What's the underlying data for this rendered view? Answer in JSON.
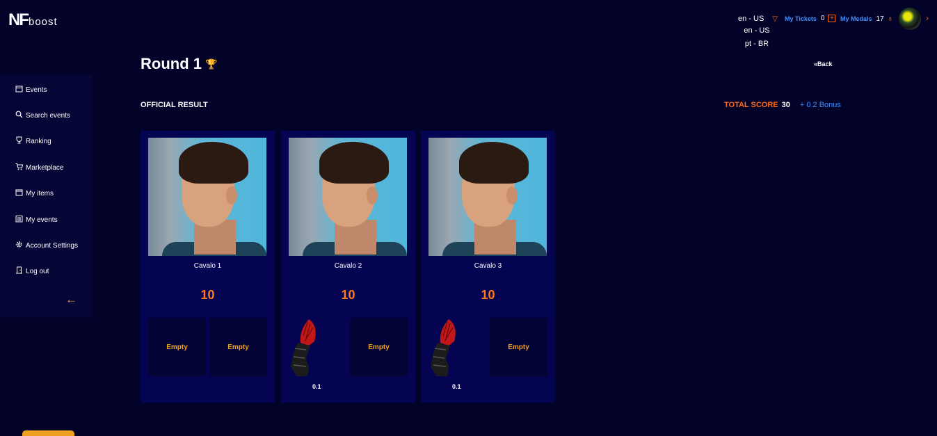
{
  "header": {
    "logo_nf": "NF",
    "logo_boost": "boost",
    "language_current": "en - US",
    "language_options": [
      "en - US",
      "pt - BR"
    ],
    "tickets_label": "My Tickets",
    "tickets_count": "0",
    "medals_label": "My Medals",
    "medals_count": "17"
  },
  "sidebar": {
    "items": [
      {
        "label": "Events",
        "icon": "calendar-icon"
      },
      {
        "label": "Search events",
        "icon": "search-icon"
      },
      {
        "label": "Ranking",
        "icon": "trophy-icon"
      },
      {
        "label": "Marketplace",
        "icon": "cart-icon"
      },
      {
        "label": "My items",
        "icon": "box-icon"
      },
      {
        "label": "My events",
        "icon": "list-icon"
      },
      {
        "label": "Account Settings",
        "icon": "gear-icon"
      },
      {
        "label": "Log out",
        "icon": "door-icon"
      }
    ]
  },
  "main": {
    "title": "Round 1",
    "back_label": "Back",
    "official_result": "OFFICIAL RESULT",
    "total_score_label": "TOTAL SCORE",
    "total_score_value": "30",
    "bonus": "+ 0.2 Bonus",
    "cards": [
      {
        "name": "Cavalo 1",
        "score": "10",
        "slots": [
          "Empty",
          "Empty"
        ],
        "item_value": ""
      },
      {
        "name": "Cavalo 2",
        "score": "10",
        "slots": [
          "item",
          "Empty"
        ],
        "item_value": "0.1"
      },
      {
        "name": "Cavalo 3",
        "score": "10",
        "slots": [
          "item",
          "Empty"
        ],
        "item_value": "0.1"
      }
    ]
  },
  "colors": {
    "background": "#03032a",
    "sidebar": "#050536",
    "card": "#040452",
    "accent_orange": "#ff6a1a",
    "accent_yellow": "#f0a020",
    "link_blue": "#3d8fff"
  }
}
